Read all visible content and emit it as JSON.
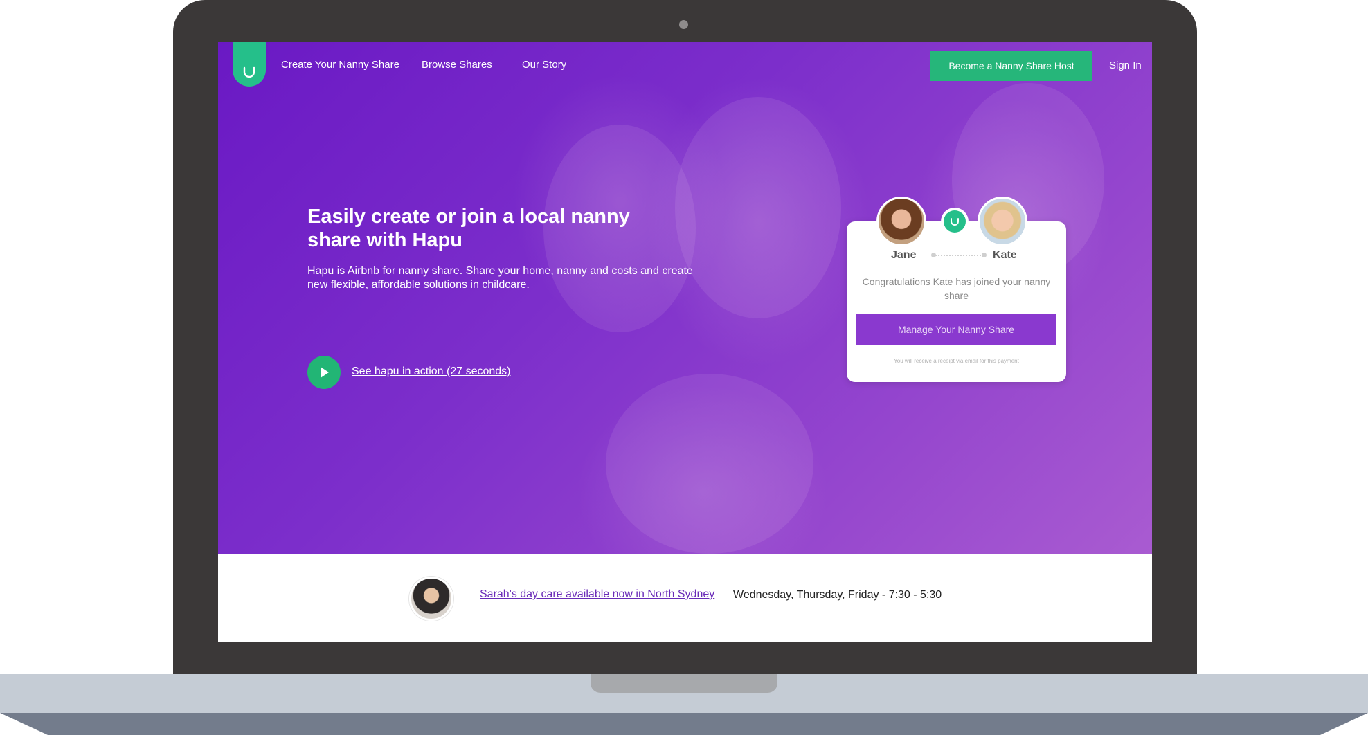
{
  "nav": {
    "links": [
      "Create Your Nanny Share",
      "Browse Shares",
      "Our Story"
    ],
    "host_button": "Become a Nanny Share Host",
    "sign_in": "Sign In"
  },
  "hero": {
    "headline": "Easily create or join a local nanny share with Hapu",
    "subtext": "Hapu is Airbnb for nanny share. Share your home, nanny and costs and create new flexible, affordable solutions in childcare.",
    "video_link": "See hapu in action (27 seconds)"
  },
  "card": {
    "name_left": "Jane",
    "name_right": "Kate",
    "message": "Congratulations Kate has joined your nanny share",
    "button": "Manage Your Nanny Share",
    "note": "You will receive a receipt via email for this payment"
  },
  "listing": {
    "link": "Sarah's day care available now in North Sydney",
    "hours": "Wednesday, Thursday, Friday - 7:30 - 5:30"
  },
  "colors": {
    "brand_green": "#25bf8a",
    "hero_purple": "#7c2ecb",
    "button_purple": "#8a39cf",
    "laptop_frame": "#3b3838"
  },
  "icons": [
    "hapu-logo-icon",
    "play-icon",
    "hapu-link-icon"
  ]
}
